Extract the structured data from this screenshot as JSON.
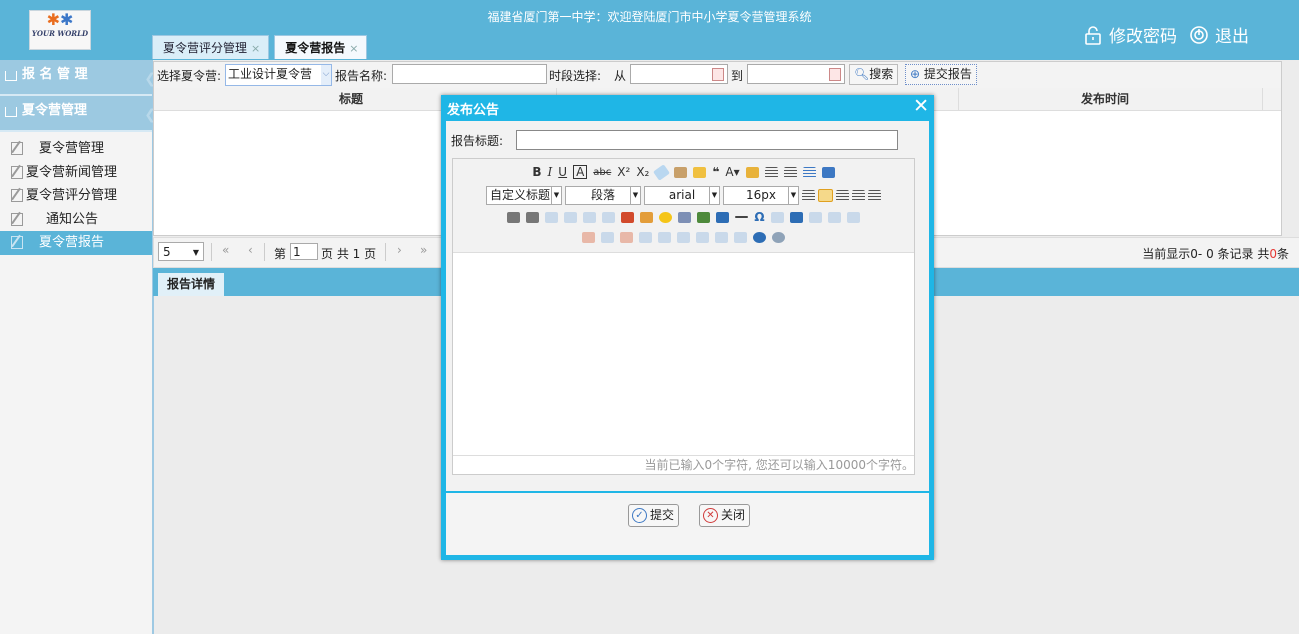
{
  "header": {
    "site_title": "福建省厦门第一中学：欢迎登陆厦门市中小学夏令营管理系统",
    "change_password": "修改密码",
    "logout": "退出",
    "logo_text": "YOUR WORLD"
  },
  "tabs": [
    {
      "label": "夏令营评分管理",
      "close": "×"
    },
    {
      "label": "夏令营报告",
      "close": "×"
    }
  ],
  "sidebar": {
    "groups": [
      {
        "label": "报 名 管 理"
      },
      {
        "label": "夏令营管理"
      }
    ],
    "items": [
      {
        "label": "夏令营管理"
      },
      {
        "label": "夏令营新闻管理"
      },
      {
        "label": "夏令营评分管理"
      },
      {
        "label": "通知公告"
      },
      {
        "label": "夏令营报告"
      }
    ]
  },
  "toolbar": {
    "camp_label": "选择夏令营:",
    "camp_value": "工业设计夏令营",
    "report_name_label": "报告名称:",
    "period_label": "时段选择:",
    "from_label": "从",
    "to_label": "到",
    "search_label": "搜索",
    "submit_report_label": "提交报告"
  },
  "grid": {
    "columns": [
      "标题",
      "发布时间"
    ]
  },
  "pager": {
    "page_size": "5",
    "page_prefix": "第",
    "page_value": "1",
    "page_suffix": "页 共 1 页",
    "summary_prefix": "当前显示0- 0 条记录 共",
    "summary_count": "0",
    "summary_suffix": "条"
  },
  "detail": {
    "tab_label": "报告详情"
  },
  "dialog": {
    "title": "发布公告",
    "field_label": "报告标题:",
    "editor": {
      "row1": [
        "B",
        "I",
        "U",
        "A",
        "abc",
        "X²",
        "X₂"
      ],
      "heading_select": "自定义标题",
      "paragraph_select": "段落",
      "font_select": "arial",
      "size_select": "16px",
      "status": "当前已输入0个字符, 您还可以输入10000个字符。"
    },
    "submit_label": "提交",
    "close_label": "关闭"
  },
  "colors": {
    "header_bg": "#5ab4d8",
    "dialog_bg": "#1fb6e6",
    "summary_count": "#e53935"
  }
}
